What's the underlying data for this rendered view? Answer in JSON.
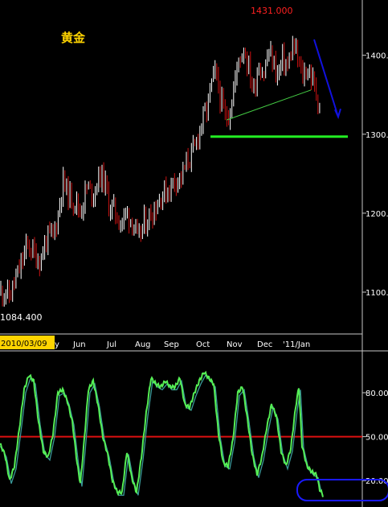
{
  "title": "黄金",
  "colors": {
    "background": "#000000",
    "frame": "#c8c8c8",
    "candle_up": "#ffffff",
    "candle_down": "#cc1111",
    "oscillator_main": "#55ee55",
    "oscillator_signal": "#3a9a9a",
    "mid_line": "#dd1111",
    "support_line": "#22ee22",
    "neckline": "#44cc44",
    "trend_arrow": "#1111dd",
    "highlight_box": "#1a1aff",
    "date_label_bg": "#ffd400"
  },
  "annotations": {
    "high_label": "1431.000",
    "low_label": "1084.400",
    "date_label": "2010/03/09"
  },
  "chart_data": [
    {
      "type": "candlestick",
      "title": "黄金",
      "ylim": [
        1047,
        1470
      ],
      "y_ticks": [
        1100,
        1200,
        1300,
        1400
      ],
      "y_tick_labels": [
        "1100.",
        "1200.",
        "1300.",
        "1400."
      ],
      "x_ticks": [
        "Jun",
        "Jul",
        "Aug",
        "Sep",
        "Oct",
        "Nov",
        "Dec",
        "'11/Jan"
      ],
      "first_label_fragment": "May",
      "close_path": [
        [
          0,
          1100
        ],
        [
          6,
          1102
        ],
        [
          12,
          1094
        ],
        [
          18,
          1112
        ],
        [
          26,
          1134
        ],
        [
          34,
          1160
        ],
        [
          42,
          1150
        ],
        [
          50,
          1140
        ],
        [
          58,
          1168
        ],
        [
          66,
          1172
        ],
        [
          72,
          1195
        ],
        [
          78,
          1240
        ],
        [
          86,
          1222
        ],
        [
          94,
          1215
        ],
        [
          100,
          1202
        ],
        [
          108,
          1232
        ],
        [
          116,
          1225
        ],
        [
          124,
          1248
        ],
        [
          130,
          1242
        ],
        [
          136,
          1208
        ],
        [
          142,
          1205
        ],
        [
          150,
          1188
        ],
        [
          158,
          1200
        ],
        [
          166,
          1188
        ],
        [
          172,
          1162
        ],
        [
          178,
          1185
        ],
        [
          186,
          1196
        ],
        [
          194,
          1210
        ],
        [
          202,
          1225
        ],
        [
          210,
          1230
        ],
        [
          218,
          1244
        ],
        [
          226,
          1245
        ],
        [
          234,
          1268
        ],
        [
          242,
          1280
        ],
        [
          250,
          1312
        ],
        [
          258,
          1332
        ],
        [
          262,
          1358
        ],
        [
          268,
          1378
        ],
        [
          274,
          1348
        ],
        [
          280,
          1320
        ],
        [
          286,
          1330
        ],
        [
          292,
          1365
        ],
        [
          298,
          1398
        ],
        [
          304,
          1410
        ],
        [
          310,
          1382
        ],
        [
          316,
          1355
        ],
        [
          322,
          1392
        ],
        [
          328,
          1375
        ],
        [
          334,
          1404
        ],
        [
          340,
          1392
        ],
        [
          346,
          1374
        ],
        [
          352,
          1396
        ],
        [
          358,
          1384
        ],
        [
          364,
          1412
        ],
        [
          370,
          1398
        ],
        [
          376,
          1372
        ],
        [
          382,
          1384
        ],
        [
          388,
          1372
        ],
        [
          394,
          1350
        ],
        [
          400,
          1330
        ]
      ],
      "high_value": 1431.0,
      "low_value": 1084.4,
      "overlays": {
        "neckline": {
          "from": [
            1318,
            282
          ],
          "to": [
            1356,
            387
          ]
        },
        "support_level": 1297,
        "down_trend_arrow": {
          "from": [
            1420,
            391
          ],
          "to": [
            1322,
            421
          ]
        }
      }
    },
    {
      "type": "line",
      "title": "",
      "ylim": [
        2,
        108
      ],
      "y_ticks": [
        20,
        50,
        80
      ],
      "y_tick_labels": [
        "20.00",
        "50.00",
        "80.00"
      ],
      "reference_line": 50,
      "series": [
        {
          "role": "main",
          "points": [
            [
              0,
              45
            ],
            [
              6,
              38
            ],
            [
              12,
              20
            ],
            [
              18,
              30
            ],
            [
              24,
              55
            ],
            [
              30,
              82
            ],
            [
              36,
              92
            ],
            [
              42,
              88
            ],
            [
              48,
              60
            ],
            [
              54,
              40
            ],
            [
              60,
              36
            ],
            [
              66,
              52
            ],
            [
              72,
              80
            ],
            [
              78,
              82
            ],
            [
              84,
              74
            ],
            [
              90,
              60
            ],
            [
              96,
              32
            ],
            [
              100,
              18
            ],
            [
              104,
              42
            ],
            [
              110,
              82
            ],
            [
              116,
              88
            ],
            [
              122,
              72
            ],
            [
              128,
              50
            ],
            [
              134,
              38
            ],
            [
              140,
              20
            ],
            [
              146,
              12
            ],
            [
              152,
              12
            ],
            [
              158,
              40
            ],
            [
              164,
              22
            ],
            [
              170,
              12
            ],
            [
              176,
              36
            ],
            [
              182,
              66
            ],
            [
              188,
              90
            ],
            [
              194,
              86
            ],
            [
              200,
              84
            ],
            [
              206,
              88
            ],
            [
              212,
              84
            ],
            [
              218,
              84
            ],
            [
              224,
              90
            ],
            [
              230,
              72
            ],
            [
              236,
              70
            ],
            [
              242,
              80
            ],
            [
              248,
              88
            ],
            [
              254,
              94
            ],
            [
              260,
              90
            ],
            [
              266,
              86
            ],
            [
              272,
              52
            ],
            [
              278,
              32
            ],
            [
              284,
              30
            ],
            [
              290,
              48
            ],
            [
              296,
              80
            ],
            [
              302,
              84
            ],
            [
              308,
              62
            ],
            [
              314,
              38
            ],
            [
              320,
              24
            ],
            [
              326,
              36
            ],
            [
              332,
              56
            ],
            [
              338,
              72
            ],
            [
              344,
              64
            ],
            [
              350,
              40
            ],
            [
              356,
              30
            ],
            [
              362,
              42
            ],
            [
              368,
              70
            ],
            [
              372,
              84
            ],
            [
              376,
              44
            ],
            [
              382,
              30
            ],
            [
              388,
              26
            ],
            [
              394,
              24
            ],
            [
              398,
              14
            ],
            [
              402,
              10
            ]
          ]
        },
        {
          "role": "signal",
          "lag": 2
        }
      ]
    }
  ]
}
